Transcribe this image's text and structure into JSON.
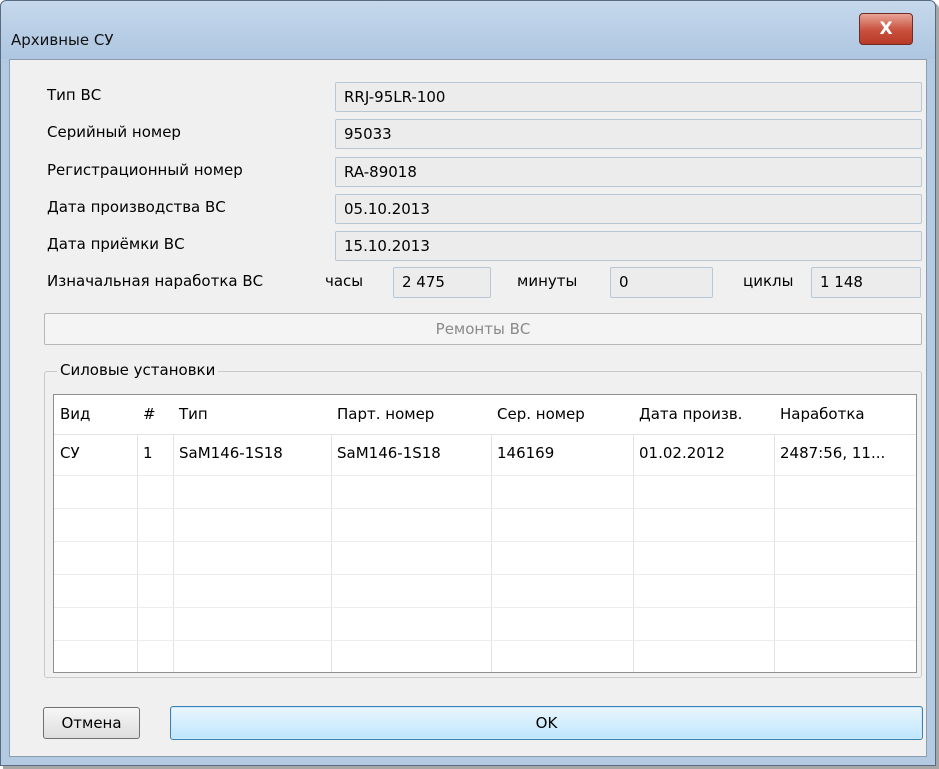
{
  "window": {
    "title": "Архивные СУ",
    "close_glyph": "X"
  },
  "form": {
    "type_label": "Тип ВС",
    "type_value": "RRJ-95LR-100",
    "serial_label": "Серийный номер",
    "serial_value": "95033",
    "reg_label": "Регистрационный номер",
    "reg_value": "RA-89018",
    "mfg_date_label": "Дата производства ВС",
    "mfg_date_value": "05.10.2013",
    "accept_date_label": "Дата приёмки ВС",
    "accept_date_value": "15.10.2013",
    "initial_time_label": "Изначальная наработка ВС",
    "hours_label": "часы",
    "hours_value": "2 475",
    "minutes_label": "минуты",
    "minutes_value": "0",
    "cycles_label": "циклы",
    "cycles_value": "1 148"
  },
  "repairs_button": "Ремонты ВС",
  "powerplants": {
    "group_label": "Силовые установки",
    "columns": [
      "Вид",
      "#",
      "Тип",
      "Парт. номер",
      "Сер. номер",
      "Дата произв.",
      "Наработка"
    ],
    "rows": [
      [
        "СУ",
        "1",
        "SaM146-1S18",
        "SaM146-1S18",
        "146169",
        "01.02.2012",
        "2487:56, 11..."
      ]
    ]
  },
  "buttons": {
    "cancel": "Отмена",
    "ok": "OK"
  },
  "colors": {
    "close_button": "#c8503d",
    "ok_button_border": "#3c7fb1",
    "frame": "#b3cae2"
  },
  "icons": {
    "close": "close-icon"
  }
}
